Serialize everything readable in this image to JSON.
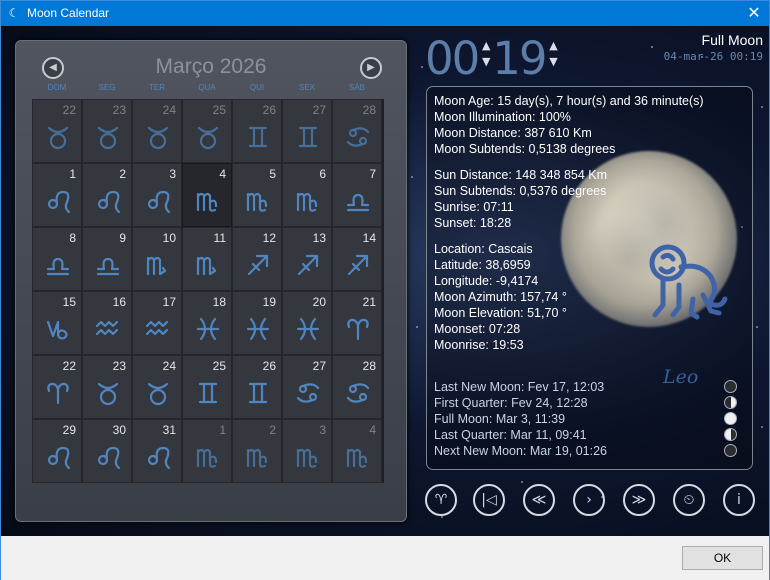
{
  "window": {
    "title": "Moon Calendar",
    "close_glyph": "✕",
    "icon": "moon-app-icon"
  },
  "calendar": {
    "month_title": "Março 2026",
    "prev_glyph": "◀",
    "next_glyph": "▶",
    "weekdays": [
      "DOM",
      "SEG",
      "TER",
      "QUA",
      "QUI",
      "SEX",
      "SÁB"
    ],
    "days": [
      {
        "n": "22",
        "sign": "taurus",
        "other": true
      },
      {
        "n": "23",
        "sign": "taurus",
        "other": true
      },
      {
        "n": "24",
        "sign": "taurus",
        "other": true
      },
      {
        "n": "25",
        "sign": "taurus",
        "other": true
      },
      {
        "n": "26",
        "sign": "gemini",
        "other": true
      },
      {
        "n": "27",
        "sign": "gemini",
        "other": true
      },
      {
        "n": "28",
        "sign": "cancer",
        "other": true
      },
      {
        "n": "1",
        "sign": "leo"
      },
      {
        "n": "2",
        "sign": "leo"
      },
      {
        "n": "3",
        "sign": "leo"
      },
      {
        "n": "4",
        "sign": "virgo",
        "today": true
      },
      {
        "n": "5",
        "sign": "virgo"
      },
      {
        "n": "6",
        "sign": "virgo"
      },
      {
        "n": "7",
        "sign": "libra"
      },
      {
        "n": "8",
        "sign": "libra"
      },
      {
        "n": "9",
        "sign": "libra"
      },
      {
        "n": "10",
        "sign": "scorpio"
      },
      {
        "n": "11",
        "sign": "scorpio"
      },
      {
        "n": "12",
        "sign": "sagittarius"
      },
      {
        "n": "13",
        "sign": "sagittarius"
      },
      {
        "n": "14",
        "sign": "sagittarius"
      },
      {
        "n": "15",
        "sign": "capricorn"
      },
      {
        "n": "16",
        "sign": "aquarius"
      },
      {
        "n": "17",
        "sign": "aquarius"
      },
      {
        "n": "18",
        "sign": "pisces"
      },
      {
        "n": "19",
        "sign": "pisces"
      },
      {
        "n": "20",
        "sign": "pisces"
      },
      {
        "n": "21",
        "sign": "aries"
      },
      {
        "n": "22",
        "sign": "aries"
      },
      {
        "n": "23",
        "sign": "taurus"
      },
      {
        "n": "24",
        "sign": "taurus"
      },
      {
        "n": "25",
        "sign": "gemini"
      },
      {
        "n": "26",
        "sign": "gemini"
      },
      {
        "n": "27",
        "sign": "cancer"
      },
      {
        "n": "28",
        "sign": "cancer"
      },
      {
        "n": "29",
        "sign": "leo"
      },
      {
        "n": "30",
        "sign": "leo"
      },
      {
        "n": "31",
        "sign": "leo"
      },
      {
        "n": "1",
        "sign": "virgo",
        "other": true
      },
      {
        "n": "2",
        "sign": "virgo",
        "other": true
      },
      {
        "n": "3",
        "sign": "virgo",
        "other": true
      },
      {
        "n": "4",
        "sign": "virgo",
        "other": true
      }
    ]
  },
  "clock": {
    "hours": "00",
    "minutes": "19",
    "up": "▲",
    "down": "▼"
  },
  "phase_name": "Full Moon",
  "date_text": "04-mar-26 00:19",
  "info": {
    "moon": [
      "Moon Age: 15 day(s), 7 hour(s) and 36 minute(s)",
      "Moon Illumination: 100%",
      "Moon Distance: 387 610 Km",
      "Moon Subtends: 0,5138 degrees"
    ],
    "sun": [
      "Sun Distance:  148 348 854 Km",
      "Sun Subtends: 0,5376 degrees",
      "Sunrise: 07:11",
      "Sunset: 18:28"
    ],
    "location": [
      "Location: Cascais",
      "Latitude: 38,6959",
      "Longitude: -9,4174",
      "Moon Azimuth: 157,74 °",
      "Moon Elevation: 51,70 °",
      "Moonset: 07:28",
      "Moonrise: 19:53"
    ],
    "phases": [
      "Last New Moon: Fev 17, 12:03",
      "First Quarter: Fev 24, 12:28",
      "Full Moon: Mar 3, 11:39",
      "Last Quarter: Mar 11, 09:41",
      "Next New Moon: Mar 19, 01:26"
    ],
    "zodiac_name": "Leo"
  },
  "toolbar": {
    "zodiac_glyph": "♈",
    "first_glyph": "|◁",
    "prev_glyph": "≪",
    "next_glyph": "›",
    "last_glyph": "≫",
    "clock_glyph": "⏲",
    "info_glyph": "i"
  },
  "ok_label": "OK",
  "colors": {
    "titlebar": "#0078d7",
    "accent": "#4f86c0",
    "clock": "#5d7ea8",
    "zodiac": "#3c5f9b"
  }
}
